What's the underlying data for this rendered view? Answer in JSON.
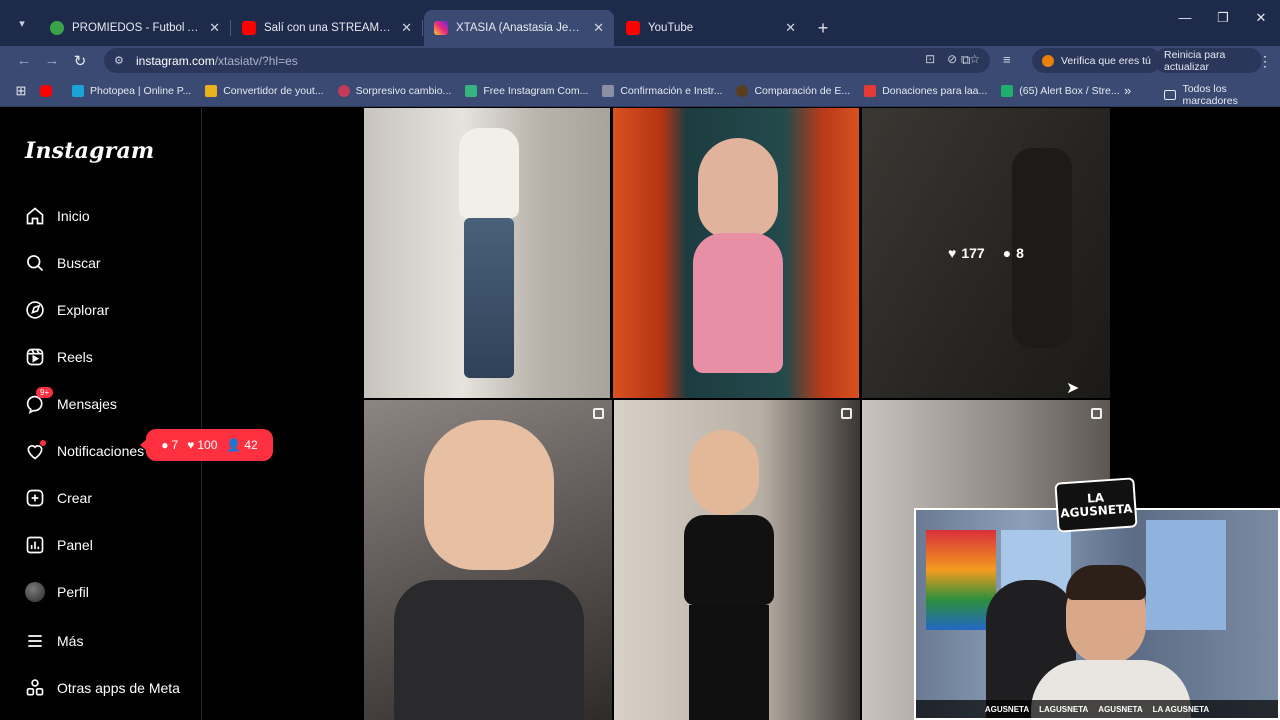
{
  "tabs": [
    {
      "title": "PROMIEDOS - Futbol Argentina",
      "favicon_color": "#3aa34a"
    },
    {
      "title": "Salí con una STREAMER LETONA",
      "favicon_color": "#ff0000"
    },
    {
      "title": "XTASIA (Anastasia Jegorova) (@",
      "favicon_color": "#d6249f",
      "active": true
    },
    {
      "title": "YouTube",
      "favicon_color": "#ff0000"
    }
  ],
  "toolbar": {
    "url_host": "instagram.com",
    "url_path": "/xtasiatv/?hl=es",
    "verify_label": "Verifica que eres tú",
    "restart_label": "Reinicia para actualizar"
  },
  "bookmarks": [
    {
      "label": "",
      "color": "#ff0000"
    },
    {
      "label": "Photopea | Online P...",
      "color": "#19a3d6"
    },
    {
      "label": "Convertidor de yout...",
      "color": "#e8b21d"
    },
    {
      "label": "Sorpresivo cambio...",
      "color": "#c23b5a"
    },
    {
      "label": "Free Instagram Com...",
      "color": "#36b37e"
    },
    {
      "label": "Confirmación e Instr...",
      "color": "#8a8fa3"
    },
    {
      "label": "Comparación de E...",
      "color": "#5a3d1c"
    },
    {
      "label": "Donaciones para laa...",
      "color": "#e53935"
    },
    {
      "label": "(65) Alert Box / Stre...",
      "color": "#1fae6c"
    }
  ],
  "bookmarks_all": "Todos los marcadores",
  "instagram": {
    "logo": "Instagram",
    "nav": [
      {
        "label": "Inicio",
        "icon": "home-icon"
      },
      {
        "label": "Buscar",
        "icon": "search-icon"
      },
      {
        "label": "Explorar",
        "icon": "compass-icon"
      },
      {
        "label": "Reels",
        "icon": "reels-icon"
      },
      {
        "label": "Mensajes",
        "icon": "messenger-icon",
        "badge": "9+"
      },
      {
        "label": "Notificaciones",
        "icon": "heart-icon"
      },
      {
        "label": "Crear",
        "icon": "plus-square-icon"
      },
      {
        "label": "Panel",
        "icon": "dashboard-icon"
      },
      {
        "label": "Perfil",
        "icon": "avatar"
      },
      {
        "label": "Más",
        "icon": "menu-icon"
      },
      {
        "label": "Otras apps de Meta",
        "icon": "meta-apps-icon"
      }
    ],
    "notifications_popup": {
      "comments": "7",
      "likes": "100",
      "followers": "42"
    },
    "hover_post": {
      "likes": "177",
      "comments": "8"
    }
  },
  "webcam": {
    "logo_line1": "LA",
    "logo_line2": "AGUSNETA",
    "socials": [
      "AGUSNETA",
      "LAGUSNETA",
      "AGUSNETA",
      "LA AGUSNETA"
    ]
  }
}
